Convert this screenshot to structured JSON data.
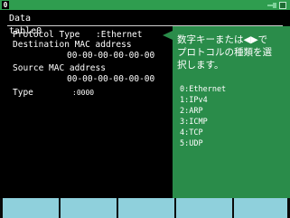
{
  "status": {
    "channel": "0",
    "icons": [
      "ac-power-icon",
      "battery-icon"
    ]
  },
  "title": "Data table0",
  "fields": [
    {
      "label": "Protocol Type",
      "value": ":Ethernet"
    },
    {
      "label": "Destination MAC address",
      "value": "00-00-00-00-00-00"
    },
    {
      "label": "Source MAC address",
      "value": "00-00-00-00-00-00"
    },
    {
      "label": "Type",
      "value": ":0000"
    }
  ],
  "help": {
    "lines": [
      "数字キーまたは◀▶で",
      "プロトコルの種類を選",
      "択します。"
    ],
    "options": [
      "0:Ethernet",
      "1:IPv4",
      "2:ARP",
      "3:ICMP",
      "4:TCP",
      "5:UDP"
    ]
  },
  "function_keys": [
    "",
    "",
    "",
    "",
    ""
  ],
  "colors": {
    "status_bar": "#2f9d4f",
    "help_panel": "#2a8c4a",
    "function_key": "#8fd0dc",
    "background": "#000000"
  }
}
